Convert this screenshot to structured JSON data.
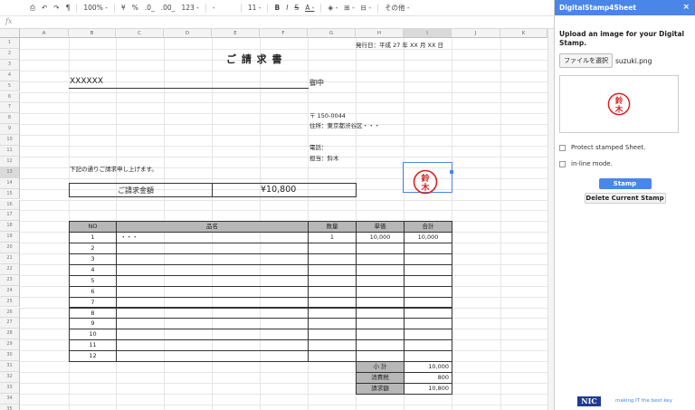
{
  "toolbar": {
    "zoom": "100% -",
    "currency": "¥",
    "percent": "%",
    "dec_less": ".0_",
    "dec_more": ".00_",
    "format_more": "123 -",
    "font_size": "11 -",
    "bold": "B",
    "italic": "I",
    "strike": "S",
    "text_color": "A -",
    "more": "その他 -"
  },
  "formula_bar": {
    "fx": "fx"
  },
  "columns": [
    "A",
    "B",
    "C",
    "D",
    "E",
    "F",
    "G",
    "H",
    "I",
    "J",
    "K"
  ],
  "rows": [
    "1",
    "2",
    "3",
    "4",
    "5",
    "6",
    "7",
    "8",
    "9",
    "10",
    "11",
    "12",
    "13",
    "14",
    "15",
    "16",
    "17",
    "18",
    "19",
    "20",
    "21",
    "22",
    "23",
    "24",
    "25",
    "26",
    "27",
    "28",
    "29",
    "30",
    "31",
    "32",
    "33",
    "34",
    "35"
  ],
  "invoice": {
    "date": "発行日：平成 27 年 XX 月 XX 日",
    "title": "ご 請 求 書",
    "client": "XXXXXX",
    "honorific": "御中",
    "postal": "〒 150-0044",
    "address": "住所：東京都渋谷区・・・",
    "phone": "電話：",
    "person": "担当：鈴木",
    "message": "下記の通りご請求申し上げます。",
    "amount_label": "ご請求金額",
    "amount": "¥10,800",
    "headers": [
      "NO",
      "品名",
      "数量",
      "単価",
      "合計"
    ],
    "items": [
      {
        "no": "1",
        "name": "・・・",
        "qty": "1",
        "price": "10,000",
        "total": "10,000"
      },
      {
        "no": "2",
        "name": "",
        "qty": "",
        "price": "",
        "total": ""
      },
      {
        "no": "3",
        "name": "",
        "qty": "",
        "price": "",
        "total": ""
      },
      {
        "no": "4",
        "name": "",
        "qty": "",
        "price": "",
        "total": ""
      },
      {
        "no": "5",
        "name": "",
        "qty": "",
        "price": "",
        "total": ""
      },
      {
        "no": "6",
        "name": "",
        "qty": "",
        "price": "",
        "total": ""
      },
      {
        "no": "7",
        "name": "",
        "qty": "",
        "price": "",
        "total": ""
      },
      {
        "no": "8",
        "name": "",
        "qty": "",
        "price": "",
        "total": ""
      },
      {
        "no": "9",
        "name": "",
        "qty": "",
        "price": "",
        "total": ""
      },
      {
        "no": "10",
        "name": "",
        "qty": "",
        "price": "",
        "total": ""
      },
      {
        "no": "11",
        "name": "",
        "qty": "",
        "price": "",
        "total": ""
      },
      {
        "no": "12",
        "name": "",
        "qty": "",
        "price": "",
        "total": ""
      }
    ],
    "subtotal_label": "小 計",
    "subtotal": "10,000",
    "tax_label": "消費税",
    "tax": "800",
    "grand_label": "請求額",
    "grand": "10,800",
    "stamp_text": "鈴木"
  },
  "panel": {
    "title": "DigitalStamp4Sheet",
    "close": "×",
    "instruction": "Upload an image for your Digital Stamp.",
    "choose_file": "ファイルを選択",
    "filename": "suzuki.png",
    "stamp_text": "鈴木",
    "protect_label": "Protect stamped Sheet.",
    "inline_label": "in-line mode.",
    "stamp_button": "Stamp",
    "delete_button": "Delete Current Stamp",
    "logo": "NIC",
    "tagline": "making IT the best key"
  },
  "colors": {
    "accent": "#4a86e8",
    "stamp_red": "#d92020",
    "header_gray": "#b7b7b7"
  }
}
